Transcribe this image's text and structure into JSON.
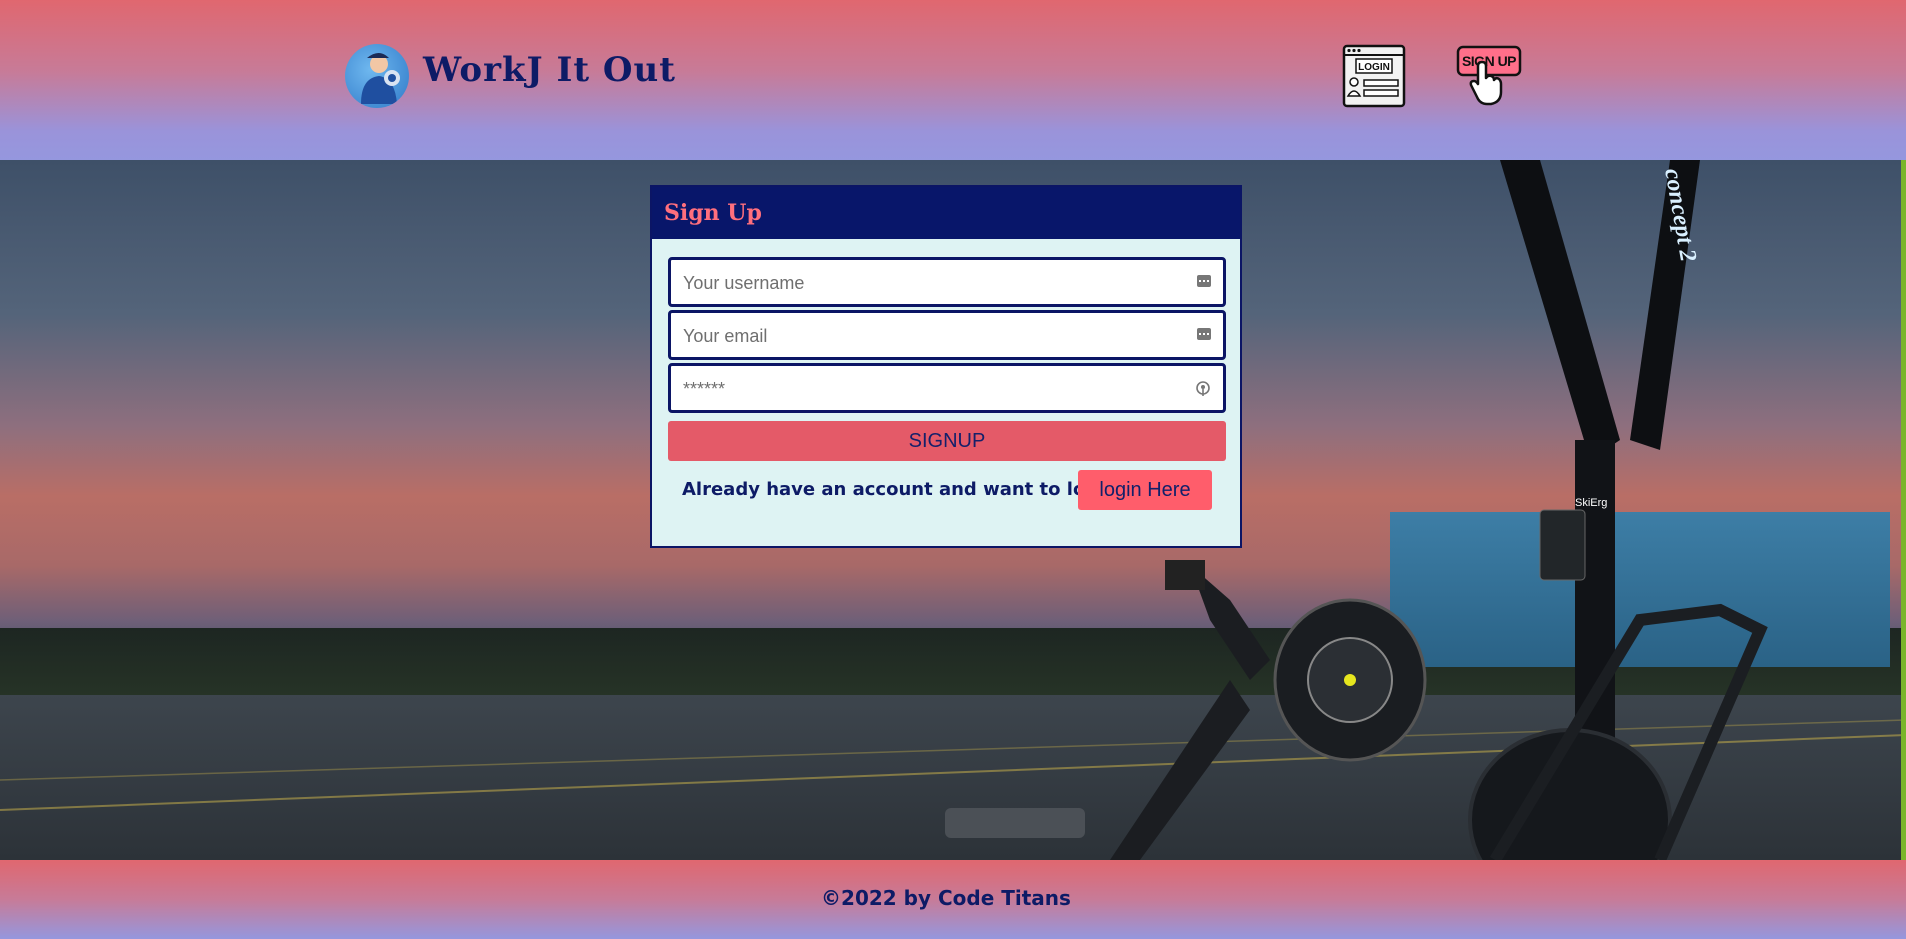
{
  "header": {
    "brand": "WorkJ It Out",
    "nav": {
      "login_label": "LOGIN",
      "signup_label": "SIGN UP"
    }
  },
  "form": {
    "title": "Sign Up",
    "username_placeholder": "Your username",
    "email_placeholder": "Your email",
    "password_placeholder": "******",
    "signup_button": "SIGNUP",
    "login_prompt": "Already have an account and want to login.",
    "login_button": "login Here"
  },
  "background": {
    "machine_brand": "concept 2",
    "machine_model": "SkiErg"
  },
  "footer": {
    "copyright": "©2022 by Code Titans"
  },
  "colors": {
    "navy": "#0d1b66",
    "coral": "#e45a68",
    "card_bg": "#def3f3"
  }
}
